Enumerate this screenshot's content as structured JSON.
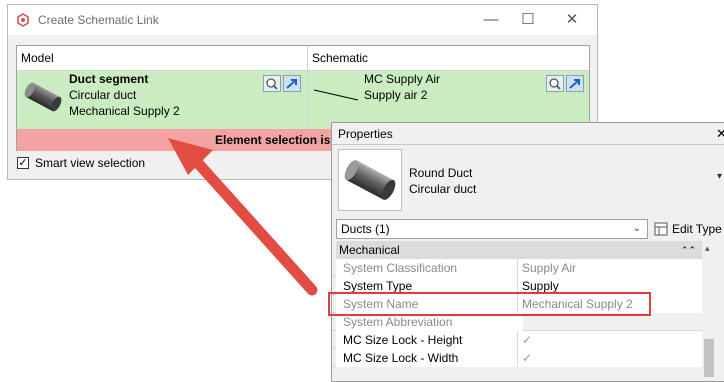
{
  "dialog": {
    "title": "Create Schematic Link",
    "minimize": "—",
    "maximize": "☐",
    "close": "✕",
    "col_model": "Model",
    "col_schematic": "Schematic",
    "model": {
      "name": "Duct segment",
      "line2": "Circular duct",
      "line3": "Mechanical Supply 2"
    },
    "schematic": {
      "name": "MC Supply Air",
      "line2": "Supply air 2"
    },
    "status": "Element selection is ongoing...",
    "smart_view": "Smart view selection",
    "smart_view_checked": true
  },
  "properties": {
    "title": "Properties",
    "close": "✕",
    "type_name": "Round Duct",
    "type_sub": "Circular duct",
    "selector": "Ducts (1)",
    "edit_type": "Edit Type",
    "group": "Mechanical",
    "group_toggle": "⌃⌃",
    "rows": [
      {
        "name": "System Classification",
        "value": "Supply Air",
        "muted": true
      },
      {
        "name": "System Type",
        "value": "Supply",
        "muted": false
      },
      {
        "name": "System Name",
        "value": "Mechanical Supply 2",
        "muted": true
      },
      {
        "name": "System Abbreviation",
        "value": "",
        "muted": true
      },
      {
        "name": "MC Size Lock - Height",
        "value": "✓",
        "muted": false
      },
      {
        "name": "MC Size Lock - Width",
        "value": "✓",
        "muted": false
      }
    ]
  },
  "colors": {
    "highlight_red": "#e23b3b",
    "row_green": "#c9ecc0",
    "status_red": "#f4a3a3",
    "arrow": "#e24c43"
  }
}
